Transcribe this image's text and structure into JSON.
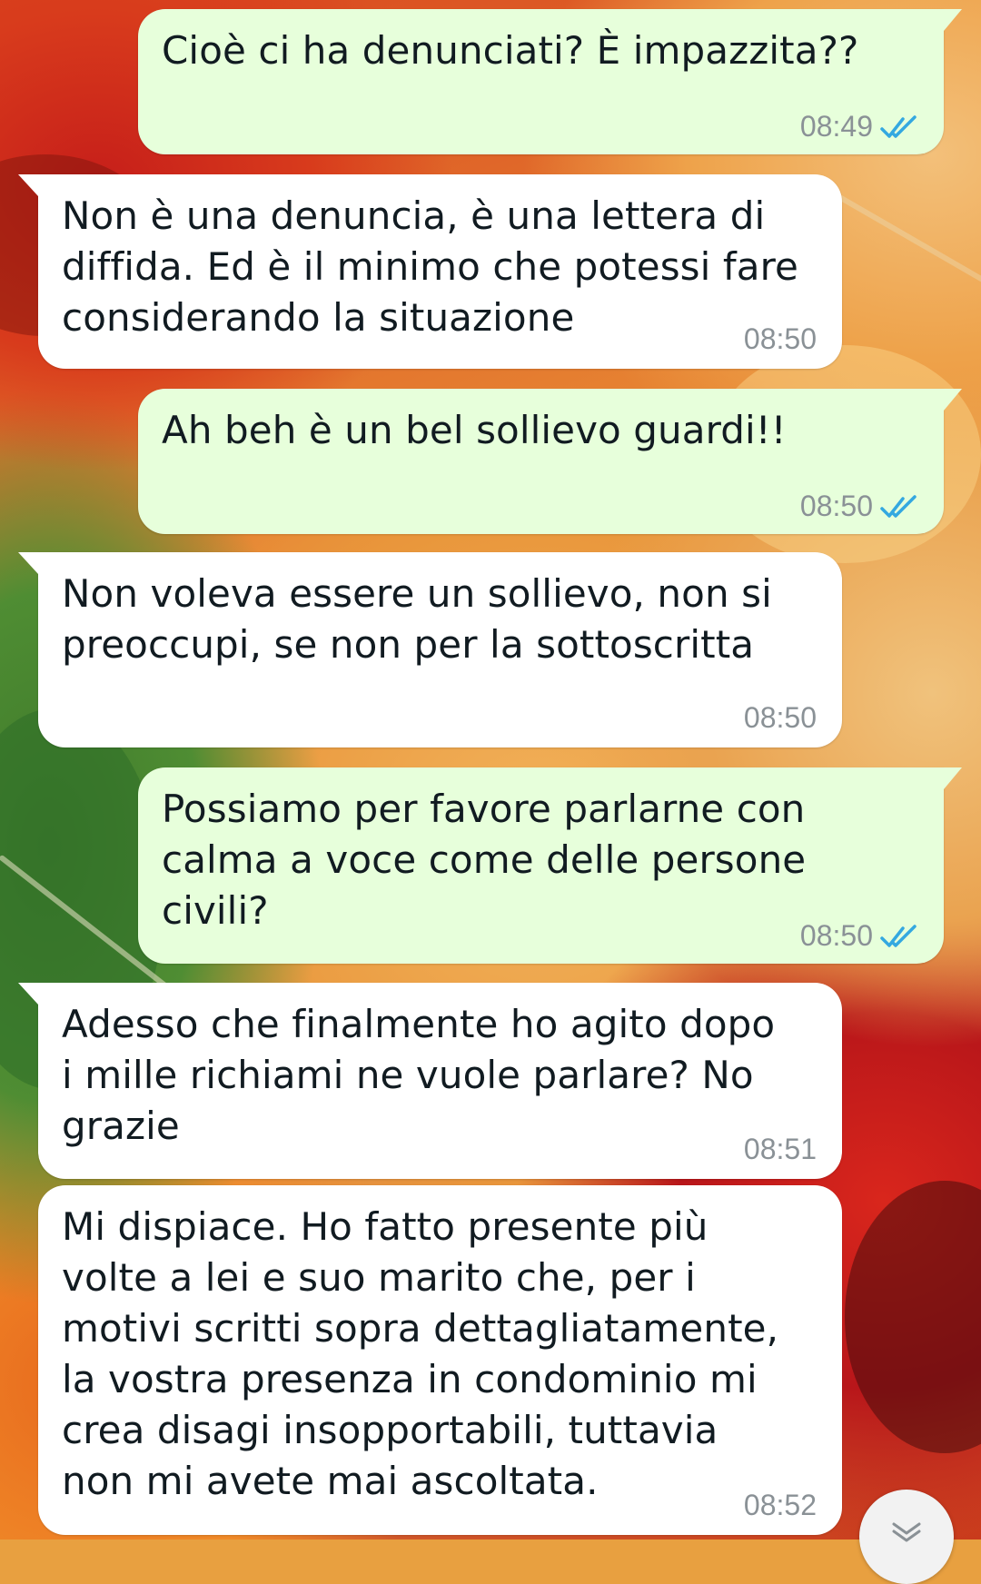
{
  "conversation": {
    "messages": [
      {
        "direction": "outgoing",
        "text": "Cioè ci ha denunciati? È impazzita??",
        "time": "08:49",
        "status": "read"
      },
      {
        "direction": "incoming",
        "text": "Non è una denuncia, è una lettera di\ndiffida. Ed è il minimo che potessi fare\nconsiderando la situazione",
        "time": "08:50"
      },
      {
        "direction": "outgoing",
        "text": "Ah beh è un bel sollievo guardi!!",
        "time": "08:50",
        "status": "read"
      },
      {
        "direction": "incoming",
        "text": "Non voleva essere un sollievo, non si\npreoccupi, se non per la sottoscritta",
        "time": "08:50"
      },
      {
        "direction": "outgoing",
        "text": "Possiamo per favore parlarne con\ncalma a voce come delle persone\ncivili?",
        "time": "08:50",
        "status": "read"
      },
      {
        "direction": "incoming",
        "text": "Adesso che finalmente ho agito dopo\ni mille richiami ne vuole parlare? No\ngrazie",
        "time": "08:51"
      },
      {
        "direction": "incoming",
        "text": "Mi dispiace. Ho fatto presente più\nvolte a lei e suo marito che, per i\nmotivi scritti sopra dettagliatamente,\nla vostra presenza in condominio mi\ncrea disagi insopportabili, tuttavia\nnon mi avete mai ascoltata.",
        "time": "08:52"
      }
    ]
  },
  "colors": {
    "outgoing_bubble": "#e7ffdb",
    "incoming_bubble": "#ffffff",
    "read_ticks": "#34a8e0",
    "time_text": "#8a9196"
  },
  "icons": {
    "read_status": "double-check-icon",
    "scroll_down": "double-chevron-down-icon"
  }
}
